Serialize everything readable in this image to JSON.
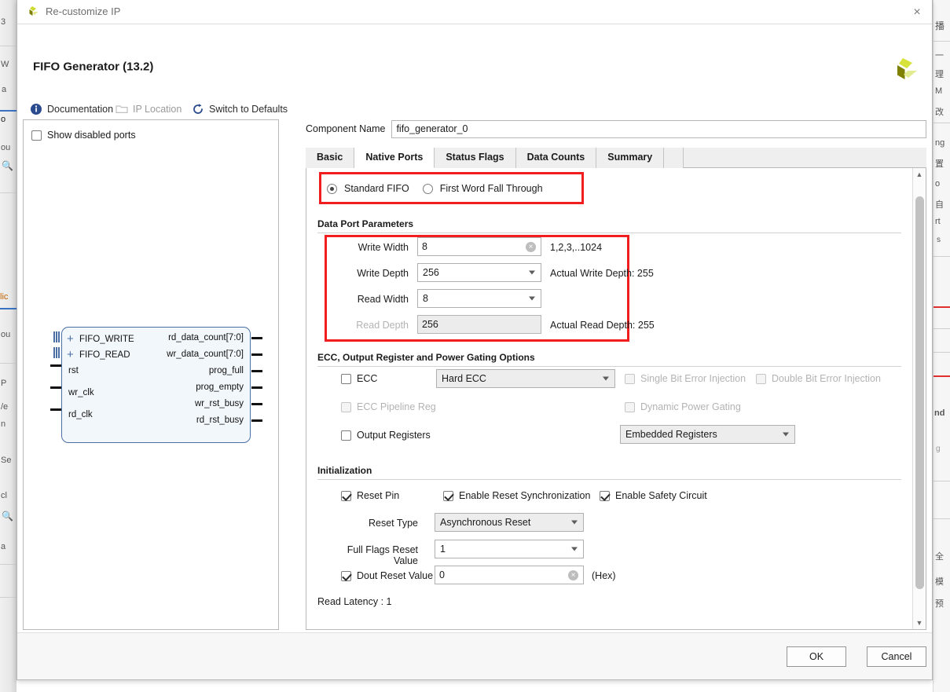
{
  "window": {
    "title": "Re-customize IP",
    "close_label": "×",
    "logo_name": "xilinx-logo"
  },
  "header": {
    "title": "FIFO Generator (13.2)",
    "links": [
      {
        "label": "Documentation",
        "icon": "info-icon",
        "disabled": false
      },
      {
        "label": "IP Location",
        "icon": "folder-icon",
        "disabled": true
      },
      {
        "label": "Switch to Defaults",
        "icon": "refresh-icon",
        "disabled": false
      }
    ]
  },
  "left_panel": {
    "show_disabled_ports": {
      "label": "Show disabled ports",
      "checked": false
    },
    "symbol": {
      "bus_inputs": [
        "FIFO_WRITE",
        "FIFO_READ"
      ],
      "inputs": [
        "rst",
        "wr_clk",
        "rd_clk"
      ],
      "outputs": [
        "rd_data_count[7:0]",
        "wr_data_count[7:0]",
        "prog_full",
        "prog_empty",
        "wr_rst_busy",
        "rd_rst_busy"
      ],
      "expand_glyph": "+"
    }
  },
  "component_name": {
    "label": "Component Name",
    "value": "fifo_generator_0"
  },
  "tabs": [
    {
      "label": "Basic",
      "active": false
    },
    {
      "label": "Native Ports",
      "active": true
    },
    {
      "label": "Status Flags",
      "active": false
    },
    {
      "label": "Data Counts",
      "active": false
    },
    {
      "label": "Summary",
      "active": false
    }
  ],
  "fifo_mode": {
    "options": [
      {
        "label": "Standard FIFO",
        "selected": true
      },
      {
        "label": "First Word Fall Through",
        "selected": false
      }
    ]
  },
  "data_port_parameters": {
    "title": "Data Port Parameters",
    "write_width": {
      "label": "Write Width",
      "value": "8",
      "hint": "1,2,3,..1024",
      "clear_glyph": "×"
    },
    "write_depth": {
      "label": "Write Depth",
      "value": "256",
      "hint": "Actual Write Depth: 255"
    },
    "read_width": {
      "label": "Read Width",
      "value": "8",
      "hint": ""
    },
    "read_depth": {
      "label": "Read Depth",
      "value": "256",
      "hint": "Actual Read Depth: 255",
      "disabled": true
    }
  },
  "ecc_section": {
    "title": "ECC, Output Register and Power Gating Options",
    "ecc": {
      "label": "ECC",
      "checked": false
    },
    "ecc_type": {
      "value": "Hard ECC",
      "disabled": true
    },
    "single_bit_error_injection": {
      "label": "Single Bit Error Injection",
      "checked": false,
      "disabled": true
    },
    "double_bit_error_injection": {
      "label": "Double Bit Error Injection",
      "checked": false,
      "disabled": true
    },
    "ecc_pipeline_reg": {
      "label": "ECC Pipeline Reg",
      "checked": false,
      "disabled": true
    },
    "dynamic_power_gating": {
      "label": "Dynamic Power Gating",
      "checked": false,
      "disabled": true
    },
    "output_registers": {
      "label": "Output Registers",
      "checked": false
    },
    "output_register_type": {
      "value": "Embedded Registers",
      "disabled": true
    }
  },
  "initialization": {
    "title": "Initialization",
    "reset_pin": {
      "label": "Reset Pin",
      "checked": true
    },
    "enable_reset_synchronization": {
      "label": "Enable Reset Synchronization",
      "checked": true
    },
    "enable_safety_circuit": {
      "label": "Enable Safety Circuit",
      "checked": true
    },
    "reset_type": {
      "label": "Reset Type",
      "value": "Asynchronous Reset",
      "disabled": true
    },
    "full_flags_reset_value": {
      "label": "Full Flags Reset Value",
      "value": "1"
    },
    "dout_reset_value": {
      "label": "Dout Reset Value",
      "checked": true,
      "value": "0",
      "suffix": "(Hex)",
      "clear_glyph": "×"
    },
    "read_latency": "Read Latency : 1"
  },
  "footer": {
    "ok_label": "OK",
    "cancel_label": "Cancel"
  },
  "scrollbar": {
    "up_glyph": "▲",
    "down_glyph": "▼"
  },
  "colors": {
    "annotation_red": "#f01e1e",
    "symbol_blue": "#4a6fa5",
    "link_text": "#2b2b2b"
  },
  "background_fragments": {
    "left": [
      "3",
      "W",
      "a",
      "o",
      "ou",
      "lic",
      "ou",
      "P",
      "/e",
      "n",
      "Se",
      "cl",
      "a"
    ],
    "right": [
      "播",
      "一",
      "理",
      "M",
      "改",
      "ng",
      "置",
      "o",
      "自",
      "rt",
      "s",
      "nd",
      "g",
      "全",
      "模",
      "预"
    ]
  }
}
